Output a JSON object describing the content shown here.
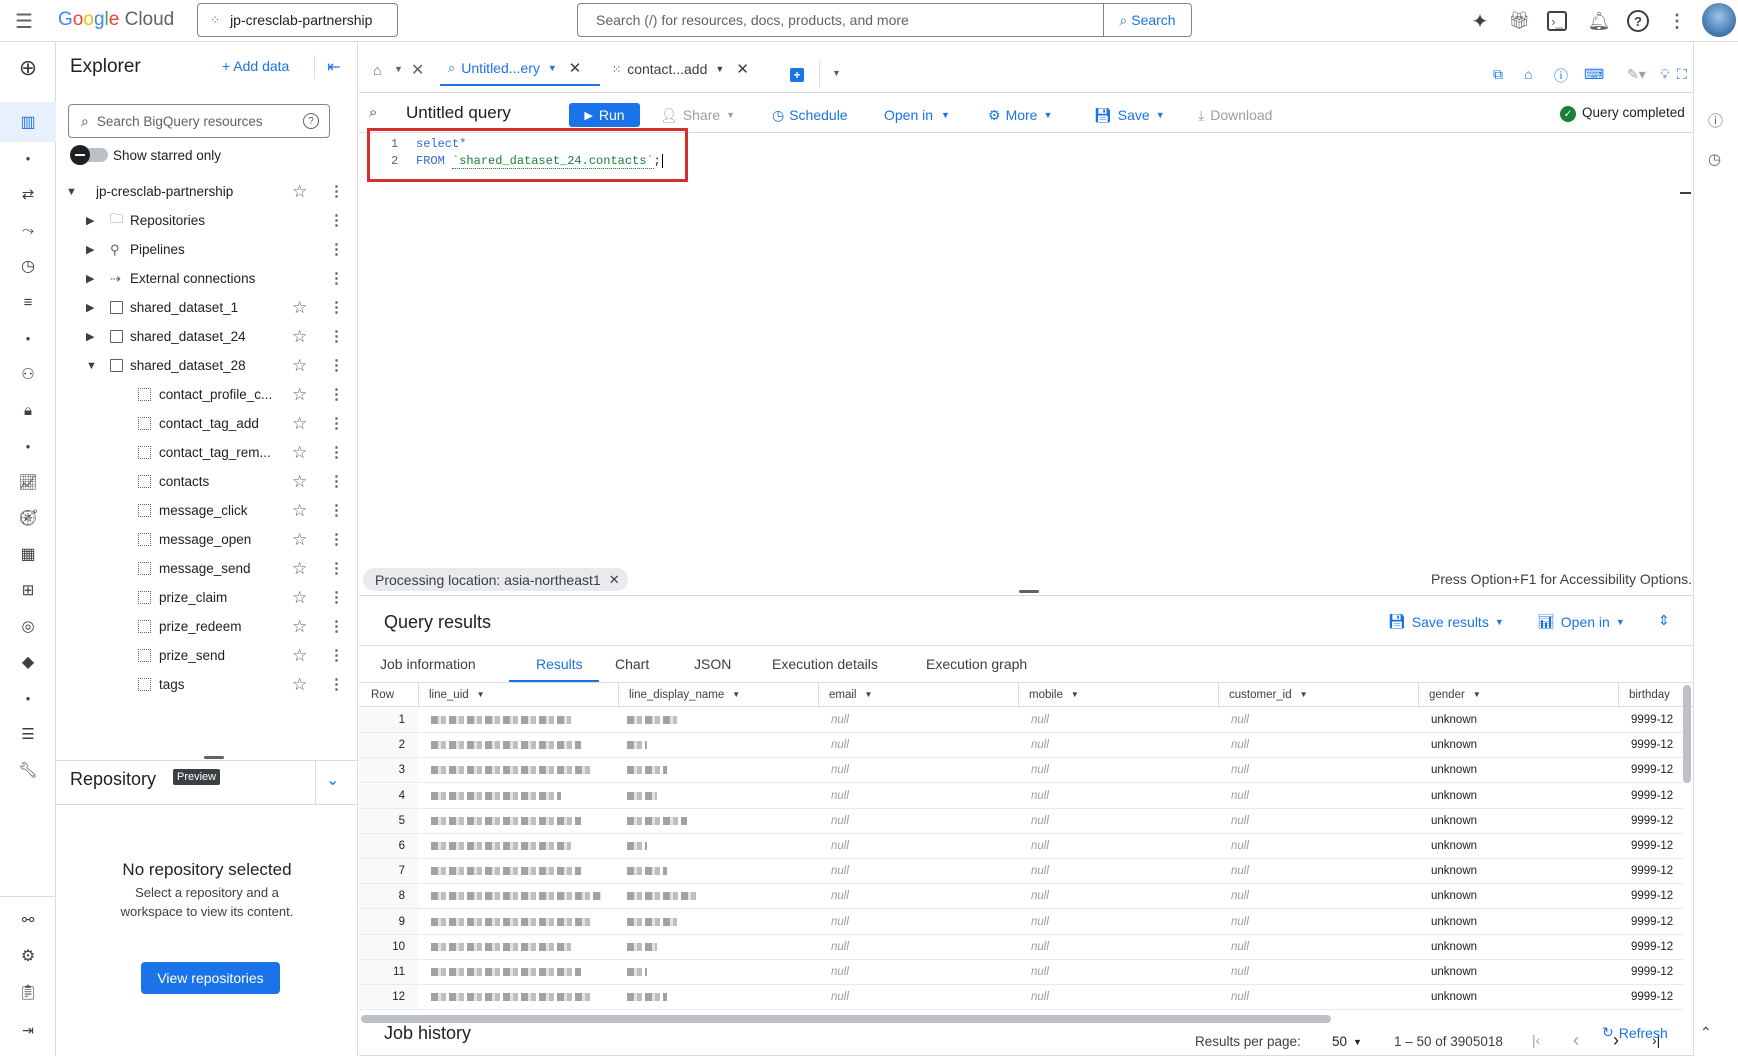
{
  "topbar": {
    "brand": "Google Cloud",
    "project": "jp-cresclab-partnership",
    "search_placeholder": "Search (/) for resources, docs, products, and more",
    "search_button": "Search"
  },
  "explorer": {
    "title": "Explorer",
    "add_data": "+ Add data",
    "search_placeholder": "Search BigQuery resources",
    "show_starred": "Show starred only",
    "project": "jp-cresclab-partnership",
    "items": [
      {
        "label": "Repositories",
        "type": "repo"
      },
      {
        "label": "Pipelines",
        "type": "pipe"
      },
      {
        "label": "External connections",
        "type": "conn"
      },
      {
        "label": "shared_dataset_1",
        "type": "dataset"
      },
      {
        "label": "shared_dataset_24",
        "type": "dataset"
      },
      {
        "label": "shared_dataset_28",
        "type": "dataset-open"
      }
    ],
    "tables": [
      "contact_profile_c...",
      "contact_tag_add",
      "contact_tag_rem...",
      "contacts",
      "message_click",
      "message_open",
      "message_send",
      "prize_claim",
      "prize_redeem",
      "prize_send",
      "tags"
    ]
  },
  "repository": {
    "title": "Repository",
    "badge": "Preview",
    "empty_title": "No repository selected",
    "empty_desc_1": "Select a repository and a",
    "empty_desc_2": "workspace to view its content.",
    "button": "View repositories"
  },
  "tabs": {
    "tab1": "Untitled...ery",
    "tab2": "contact...add"
  },
  "editor": {
    "title": "Untitled query",
    "run": "Run",
    "share": "Share",
    "schedule": "Schedule",
    "open_in": "Open in",
    "more": "More",
    "save": "Save",
    "download": "Download",
    "status": "Query completed",
    "line1_num": "1",
    "line2_num": "2",
    "line1": "select*",
    "line2_kw": "FROM",
    "line2_tbl": "`shared_dataset_24.contacts`",
    "line2_end": ";",
    "processing": "Processing location: asia-northeast1",
    "accessibility": "Press Option+F1 for Accessibility Options."
  },
  "results": {
    "title": "Query results",
    "save_results": "Save results",
    "open_in": "Open in",
    "tabs": [
      "Job information",
      "Results",
      "Chart",
      "JSON",
      "Execution details",
      "Execution graph"
    ],
    "columns": [
      "Row",
      "line_uid",
      "line_display_name",
      "email",
      "mobile",
      "customer_id",
      "gender",
      "birthday"
    ],
    "rows": [
      "1",
      "2",
      "3",
      "4",
      "5",
      "6",
      "7",
      "8",
      "9",
      "10",
      "11",
      "12"
    ],
    "null_text": "null",
    "gender_val": "unknown",
    "birthday_val": "9999-12",
    "per_page_label": "Results per page:",
    "per_page": "50",
    "range": "1 – 50 of 3905018"
  },
  "job_history": {
    "title": "Job history",
    "refresh": "Refresh"
  }
}
